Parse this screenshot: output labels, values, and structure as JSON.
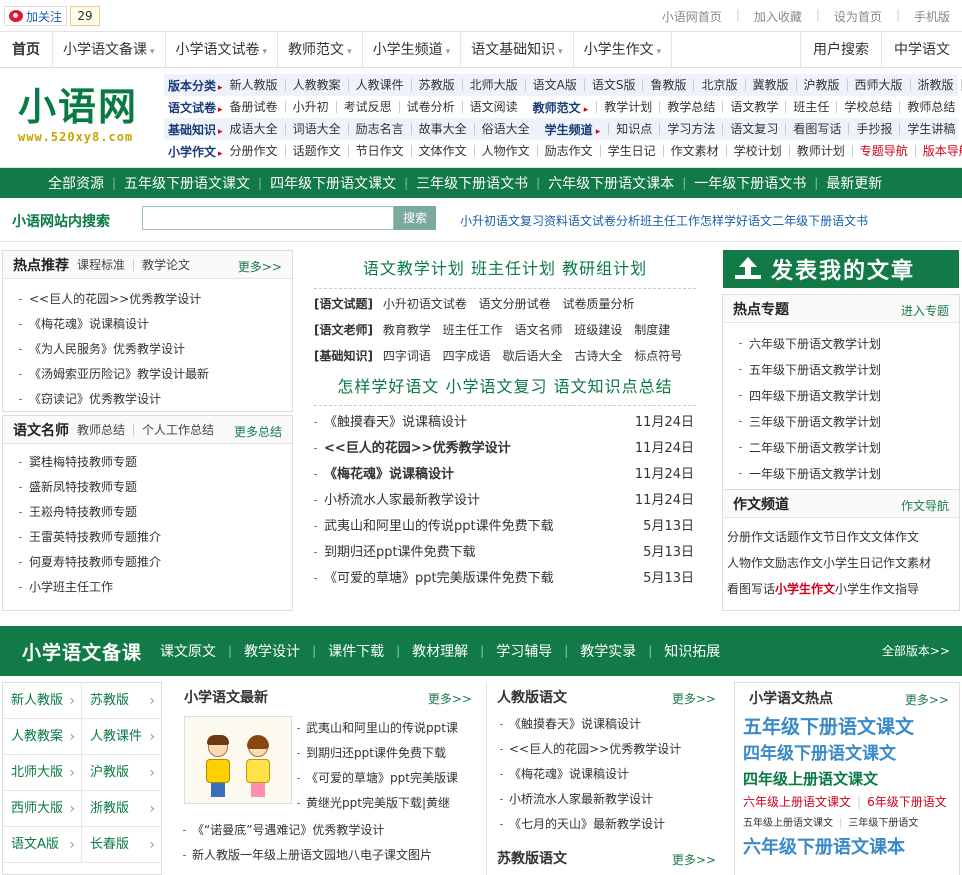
{
  "topbar": {
    "follow_label": "加关注",
    "follow_count": "29",
    "links": [
      "小语网首页",
      "加入收藏",
      "设为首页",
      "手机版"
    ]
  },
  "nav": {
    "home": "首页",
    "items": [
      "小学语文备课",
      "小学语文试卷",
      "教师范文",
      "小学生频道",
      "语文基础知识",
      "小学生作文"
    ],
    "right": [
      "用户搜索",
      "中学语文"
    ]
  },
  "logo": {
    "text": "小语网",
    "url": "www.520xy8.com"
  },
  "categories": [
    {
      "head": "版本分类",
      "links": [
        "新人教版",
        "人教教案",
        "人教课件",
        "苏教版",
        "北师大版",
        "语文A版",
        "语文S版",
        "鲁教版",
        "北京版",
        "冀教版",
        "沪教版",
        "西师大版",
        "浙教版"
      ],
      "more": ">>"
    },
    {
      "head": "语文试卷",
      "links": [
        "备册试卷",
        "小升初",
        "考试反思",
        "试卷分析",
        "语文阅读"
      ],
      "sub": "教师范文",
      "links2": [
        "教学计划",
        "教学总结",
        "语文教学",
        "班主任",
        "学校总结",
        "教师总结"
      ]
    },
    {
      "head": "基础知识",
      "links": [
        "成语大全",
        "词语大全",
        "励志名言",
        "故事大全",
        "俗语大全"
      ],
      "sub": "学生频道",
      "links2": [
        "知识点",
        "学习方法",
        "语文复习",
        "看图写话",
        "手抄报",
        "学生讲稿"
      ]
    },
    {
      "head": "小学作文",
      "links": [
        "分册作文",
        "话题作文",
        "节日作文",
        "文体作文",
        "人物作文",
        "励志作文",
        "学生日记",
        "作文素材",
        "学校计划",
        "教师计划"
      ],
      "red_links": [
        "专题导航",
        "版本导航"
      ]
    }
  ],
  "greenbar": [
    "全部资源",
    "五年级下册语文课文",
    "四年级下册语文课文",
    "三年级下册语文书",
    "六年级下册语文课本",
    "一年级下册语文书",
    "最新更新"
  ],
  "search": {
    "label": "小语网站内搜索",
    "placeholder": "",
    "button": "搜索",
    "links": [
      "小升初语文复习资料",
      "语文试卷分析",
      "班主任工作",
      "怎样学好语文",
      "二年级下册语文书"
    ]
  },
  "hot": {
    "title": "热点推荐",
    "tabs": [
      "课程标准",
      "教学论文"
    ],
    "more": "更多>>",
    "items": [
      "<<巨人的花园>>优秀教学设计",
      "《梅花魂》说课稿设计",
      "《为人民服务》优秀教学设计",
      "《汤姆索亚历险记》教学设计最新",
      "《窃读记》优秀教学设计"
    ]
  },
  "teacher": {
    "title": "语文名师",
    "tabs": [
      "教师总结",
      "个人工作总结"
    ],
    "more": "更多总结",
    "items": [
      "窦桂梅特技教师专题",
      "盛新凤特技教师专题",
      "王崧舟特技教师专题",
      "王雷英特技教师专题推介",
      "何夏寿特技教师专题推介",
      "小学班主任工作"
    ]
  },
  "center": {
    "title1": [
      "语文教学计划",
      "班主任计划",
      "教研组计划"
    ],
    "rows": [
      {
        "k": "[语文试题]",
        "v": [
          "小升初语文试卷",
          "语文分册试卷",
          "试卷质量分析"
        ]
      },
      {
        "k": "[语文老师]",
        "v": [
          "教育教学",
          "班主任工作",
          "语文名师",
          "班级建设",
          "制度建"
        ]
      },
      {
        "k": "[基础知识]",
        "v": [
          "四字词语",
          "四字成语",
          "歇后语大全",
          "古诗大全",
          "标点符号"
        ]
      }
    ],
    "title2": [
      "怎样学好语文",
      "小学语文复习",
      "语文知识点总结"
    ],
    "list": [
      {
        "t": "《触摸春天》说课稿设计",
        "d": "11月24日"
      },
      {
        "t": "<<巨人的花园>>优秀教学设计",
        "d": "11月24日"
      },
      {
        "t": "《梅花魂》说课稿设计",
        "d": "11月24日"
      },
      {
        "t": "小桥流水人家最新教学设计",
        "d": "11月24日"
      },
      {
        "t": "武夷山和阿里山的传说ppt课件免费下载",
        "d": "5月13日"
      },
      {
        "t": "到期归还ppt课件免费下载",
        "d": "5月13日"
      },
      {
        "t": "《可爱的草塘》ppt完美版课件免费下载",
        "d": "5月13日"
      }
    ]
  },
  "publish": {
    "label": "发表我的文章"
  },
  "topics": {
    "title": "热点专题",
    "more": "进入专题",
    "items": [
      "六年级下册语文教学计划",
      "五年级下册语文教学计划",
      "四年级下册语文教学计划",
      "三年级下册语文教学计划",
      "二年级下册语文教学计划",
      "一年级下册语文教学计划"
    ]
  },
  "composition": {
    "title": "作文频道",
    "more": "作文导航",
    "rows": [
      [
        "分册作文",
        "话题作文",
        "节日作文",
        "文体作文"
      ],
      [
        "人物作文",
        "励志作文",
        "小学生日记",
        "作文素材"
      ],
      [
        "看图写话",
        "小学生作文",
        "小学生作文指导"
      ]
    ]
  },
  "section": {
    "title": "小学语文备课",
    "links": [
      "课文原文",
      "教学设计",
      "课件下载",
      "教材理解",
      "学习辅导",
      "教学实录",
      "知识拓展"
    ],
    "more": "全部版本>>"
  },
  "versions": [
    [
      "新人教版",
      "苏教版"
    ],
    [
      "人教教案",
      "人教课件"
    ],
    [
      "北师大版",
      "沪教版"
    ],
    [
      "西师大版",
      "浙教版"
    ],
    [
      "语文A版",
      "长春版"
    ]
  ],
  "latest": {
    "title": "小学语文最新",
    "more": "更多>>",
    "pic_items": [
      "武夷山和阿里山的传说ppt课",
      "到期归还ppt课件免费下载",
      "《可爱的草塘》ppt完美版课",
      "黄继光ppt完美版下载|黄继"
    ],
    "items": [
      "《“诺曼底”号遇难记》优秀教学设计",
      "新人教版一年级上册语文园地八电子课文图片"
    ]
  },
  "renjiao": {
    "title": "人教版语文",
    "more": "更多>>",
    "items": [
      "《触摸春天》说课稿设计",
      "<<巨人的花园>>优秀教学设计",
      "《梅花魂》说课稿设计",
      "小桥流水人家最新教学设计",
      "《七月的天山》最新教学设计"
    ],
    "title2": "苏教版语文",
    "more2": "更多>>"
  },
  "hotspot": {
    "title": "小学语文热点",
    "more": "更多>>",
    "h1": "五年级下册语文课文",
    "h2": "四年级下册语文课文",
    "h3": "四年级上册语文课文",
    "r1": [
      "六年级上册语文课文",
      "6年级下册语文"
    ],
    "r2": [
      "五年级上册语文课文",
      "三年级下册语文"
    ],
    "h4": "六年级下册语文课本"
  }
}
